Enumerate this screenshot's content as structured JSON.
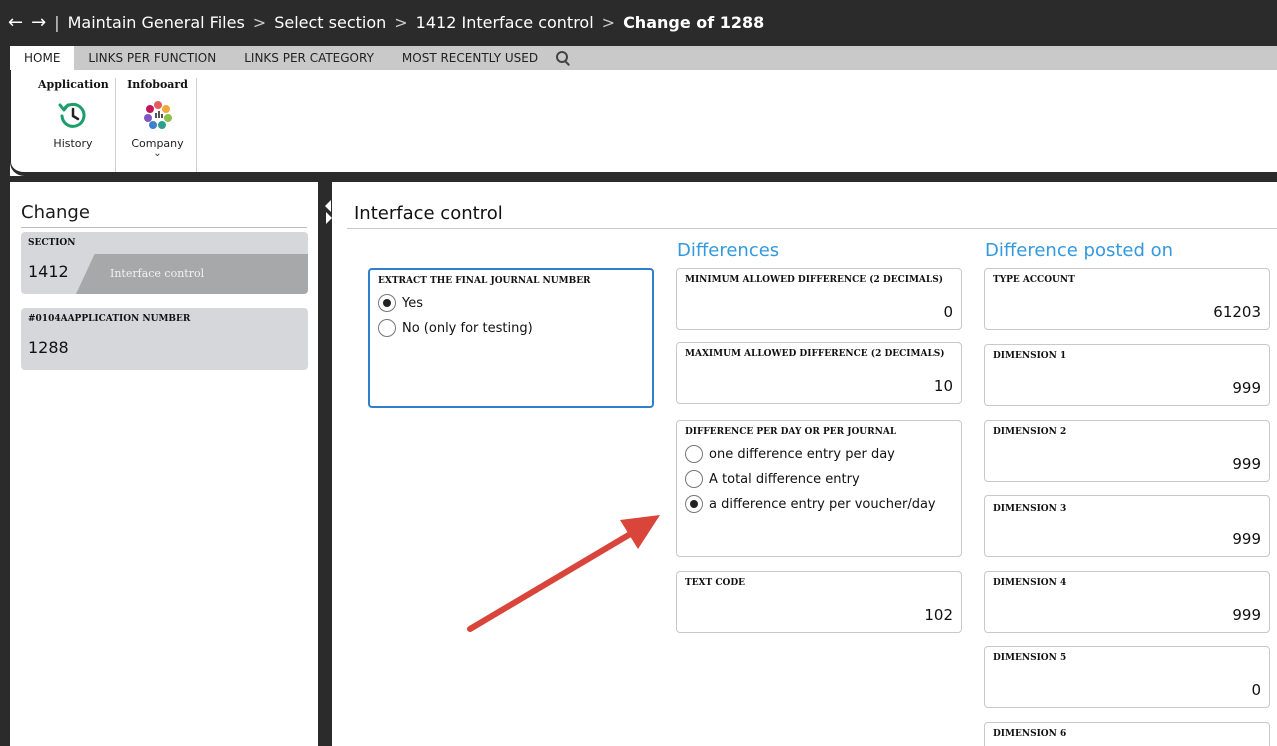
{
  "titlebar": {
    "back": "←",
    "forward": "→",
    "divider": "|",
    "crumb1": "Maintain General Files",
    "crumb2": "Select section",
    "crumb3": "1412 Interface control",
    "crumb4": "Change of  1288",
    "chevron": ">"
  },
  "tabs": {
    "home": "HOME",
    "links_function": "LINKS PER FUNCTION",
    "links_category": "LINKS PER CATEGORY",
    "most_recent": "MOST RECENTLY USED"
  },
  "ribbon": {
    "application_title": "Application",
    "history_label": "History",
    "infoboard_title": "Infoboard",
    "company_label": "Company",
    "chevron": "⌄"
  },
  "left": {
    "title": "Change",
    "section_label": "SECTION",
    "section_value": "1412",
    "section_desc": "Interface control",
    "app_label": "#0104AAPPLICATION NUMBER",
    "app_value": "1288"
  },
  "main": {
    "title": "Interface control",
    "differences_heading": "Differences",
    "posted_heading": "Difference posted on",
    "extract": {
      "label": "EXTRACT THE FINAL JOURNAL NUMBER",
      "options": [
        "Yes",
        "No (only for testing)"
      ],
      "selected": 0
    },
    "min_diff": {
      "label": "MINIMUM ALLOWED DIFFERENCE (2 DECIMALS)",
      "value": "0"
    },
    "max_diff": {
      "label": "MAXIMUM ALLOWED DIFFERENCE (2 DECIMALS)",
      "value": "10"
    },
    "per_day": {
      "label": "DIFFERENCE PER DAY OR PER JOURNAL",
      "options": [
        "one difference entry per day",
        "A total difference entry",
        "a difference entry per voucher/day"
      ],
      "selected": 2
    },
    "text_code": {
      "label": "TEXT CODE",
      "value": "102"
    },
    "type_account": {
      "label": "TYPE ACCOUNT",
      "value": "61203"
    },
    "dim1": {
      "label": "DIMENSION 1",
      "value": "999"
    },
    "dim2": {
      "label": "DIMENSION 2",
      "value": "999"
    },
    "dim3": {
      "label": "DIMENSION 3",
      "value": "999"
    },
    "dim4": {
      "label": "DIMENSION 4",
      "value": "999"
    },
    "dim5": {
      "label": "DIMENSION 5",
      "value": "0"
    },
    "dim6": {
      "label": "DIMENSION 6",
      "value": ""
    }
  },
  "colors": {
    "accent": "#3399dd",
    "selected_border": "#2f7fd0",
    "annotation_arrow": "#d9443b",
    "titlebar": "#2b2b2b"
  }
}
